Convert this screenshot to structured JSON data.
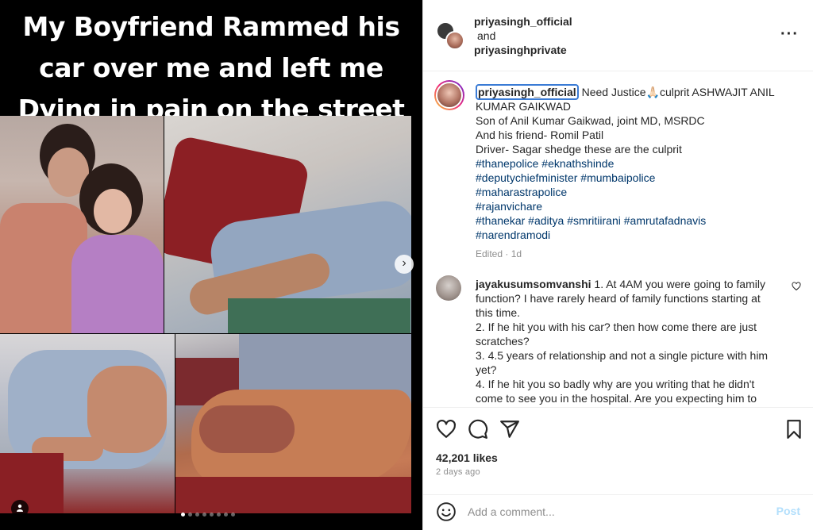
{
  "media": {
    "headline_lines": [
      "My Boyfriend Rammed his",
      "car over me and left me",
      "Dying in pain on the street"
    ],
    "icons": {
      "next": "chevron-right-icon",
      "tag": "user-tag-icon"
    },
    "carousel_dots": 8,
    "active_dot": 0
  },
  "header": {
    "username_1": "priyasingh_official",
    "conjunction": "and",
    "username_2": "priyasinghprivate",
    "more_icon": "more-horizontal-icon"
  },
  "caption": {
    "username": "priyasingh_official",
    "lines": [
      "Need Justice🙏🏻culprit ASHWAJIT ANIL",
      "KUMAR GAIKWAD",
      "Son of Anil Kumar Gaikwad, joint MD, MSRDC",
      "And his friend- Romil Patil",
      "Driver- Sagar shedge these are the culprit"
    ],
    "hashtags": [
      "#thanepolice #eknathshinde",
      "#deputychiefminister #mumbaipolice",
      "#maharastrapolice",
      "#rajanvichare",
      "#thanekar #aditya #smritiirani #amrutafadnavis",
      "#narendramodi"
    ],
    "edited": "Edited · 1d"
  },
  "comment": {
    "username": "jayakusumsomvanshi",
    "lines": [
      "1. At 4AM you were going to family",
      "function? I have rarely heard of family functions starting at",
      "this time.",
      "2. If he hit you with his car? then how come there are just",
      "scratches?",
      "3. 4.5 years of relationship and not a single picture with him",
      "yet?",
      "4. If he hit you so badly why are you writing that he didn't",
      "come to see you in the hospital. Are you expecting him to"
    ]
  },
  "actions": {
    "likes": "42,201 likes",
    "time_ago": "2 days ago",
    "icons": [
      "heart-icon",
      "comment-icon",
      "share-icon",
      "bookmark-icon"
    ]
  },
  "add_comment": {
    "placeholder": "Add a comment...",
    "post_label": "Post",
    "emoji_icon": "emoji-icon"
  }
}
